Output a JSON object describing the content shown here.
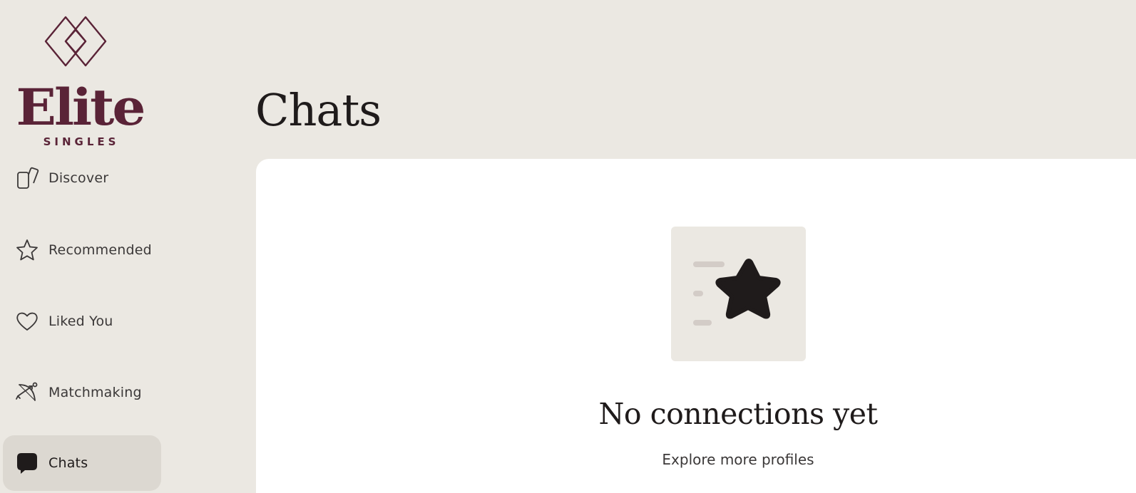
{
  "brand": {
    "name": "Elite",
    "tagline": "SINGLES",
    "color": "#5a2337"
  },
  "sidebar": {
    "items": [
      {
        "label": "Discover",
        "icon": "cards-icon",
        "active": false
      },
      {
        "label": "Recommended",
        "icon": "star-icon",
        "active": false
      },
      {
        "label": "Liked You",
        "icon": "heart-icon",
        "active": false
      },
      {
        "label": "Matchmaking",
        "icon": "bow-arrow-icon",
        "active": false
      },
      {
        "label": "Chats",
        "icon": "chat-bubble-icon",
        "active": true
      }
    ]
  },
  "page": {
    "title": "Chats"
  },
  "empty_state": {
    "icon": "star-list-icon",
    "title": "No connections yet",
    "subtitle": "Explore more profiles"
  },
  "colors": {
    "background": "#ebe8e2",
    "card": "#ffffff",
    "active_nav": "#dcd8d1",
    "text": "#1f1b1b"
  }
}
